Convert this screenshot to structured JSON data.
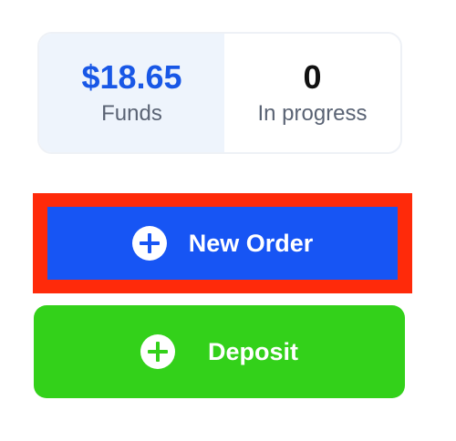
{
  "stats": {
    "funds_value": "$18.65",
    "funds_label": "Funds",
    "progress_value": "0",
    "progress_label": "In progress"
  },
  "actions": {
    "new_order_label": "New Order",
    "deposit_label": "Deposit"
  },
  "icons": {
    "new_order_icon": "plus-circle-icon",
    "deposit_icon": "plus-circle-icon"
  },
  "colors": {
    "funds_value": "#1857e6",
    "new_order_button": "#1755f4",
    "deposit_button": "#33d11a",
    "highlight_border": "#ff2a0a"
  }
}
